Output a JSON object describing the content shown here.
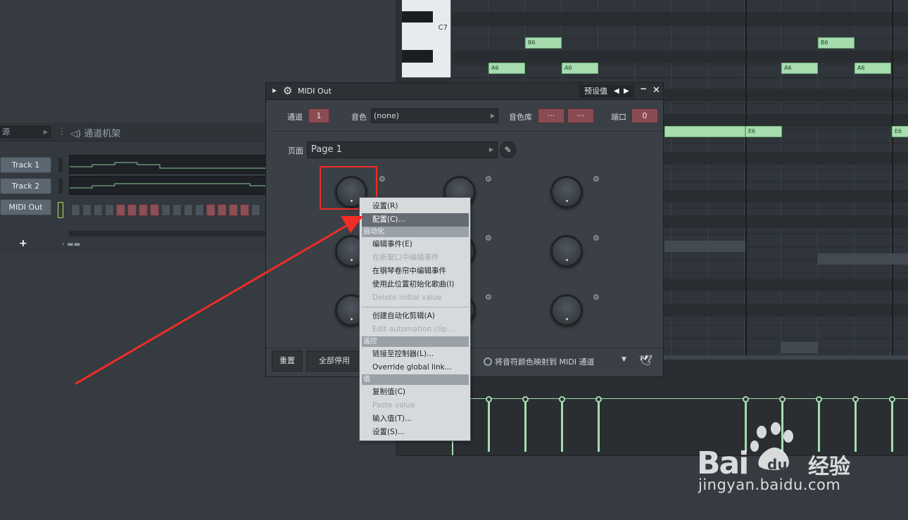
{
  "piano_roll": {
    "key_label": "C7",
    "notes": [
      {
        "label": "B6"
      },
      {
        "label": "B6"
      },
      {
        "label": "A6"
      },
      {
        "label": "A6"
      },
      {
        "label": "A6"
      },
      {
        "label": "A6"
      },
      {
        "label": "E6"
      },
      {
        "label": "E6"
      }
    ]
  },
  "channel_rack": {
    "source_label": "源",
    "title": "通道机架",
    "tracks": [
      "Track 1",
      "Track 2",
      "MIDI Out"
    ],
    "add_symbol": "+",
    "zoom_symbol": "‹ ▬▬"
  },
  "plugin": {
    "title": "MIDI Out",
    "presets_label": "预设值",
    "channel_label": "通道",
    "channel_value": "1",
    "sound_label": "音色",
    "sound_value": "(none)",
    "bank_label": "音色库",
    "bank_value_1": "···",
    "bank_value_2": "···",
    "port_label": "端口",
    "port_value": "0",
    "page_label": "页面",
    "page_value": "Page 1",
    "reset_label": "重置",
    "disable_all_label": "全部停用",
    "map_colors_label": "将音符颜色映射到 MIDI 通道"
  },
  "context_menu": {
    "items": [
      {
        "label": "设置(R)",
        "state": "normal"
      },
      {
        "label": "配置(C)...",
        "state": "selected"
      },
      {
        "section": "自动化"
      },
      {
        "label": "编辑事件(E)",
        "state": "normal"
      },
      {
        "label": "在新窗口中编辑事件",
        "state": "disabled"
      },
      {
        "label": "在钢琴卷帘中编辑事件",
        "state": "normal"
      },
      {
        "label": "使用此位置初始化歌曲(I)",
        "state": "normal"
      },
      {
        "label": "Delete initial value",
        "state": "disabled"
      },
      {
        "separator": true
      },
      {
        "label": "创建自动化剪辑(A)",
        "state": "normal"
      },
      {
        "label": "Edit automation clip...",
        "state": "disabled"
      },
      {
        "section": "遥控"
      },
      {
        "label": "链接至控制器(L)...",
        "state": "normal"
      },
      {
        "label": "Override global link...",
        "state": "normal"
      },
      {
        "section": "值"
      },
      {
        "label": "复制值(C)",
        "state": "normal"
      },
      {
        "label": "Paste value",
        "state": "disabled"
      },
      {
        "label": "输入值(T)...",
        "state": "normal"
      },
      {
        "label": "设置(S)...",
        "state": "normal"
      }
    ]
  },
  "watermark": {
    "brand_bai": "Bai",
    "brand_du": "du",
    "brand_cn": "经验",
    "url": "jingyan.baidu.com"
  },
  "colors": {
    "note_green": "#a6dcae",
    "param_red": "#8a4c52",
    "annotation_red": "#ef2d26",
    "menu_highlight": "#646b72"
  }
}
